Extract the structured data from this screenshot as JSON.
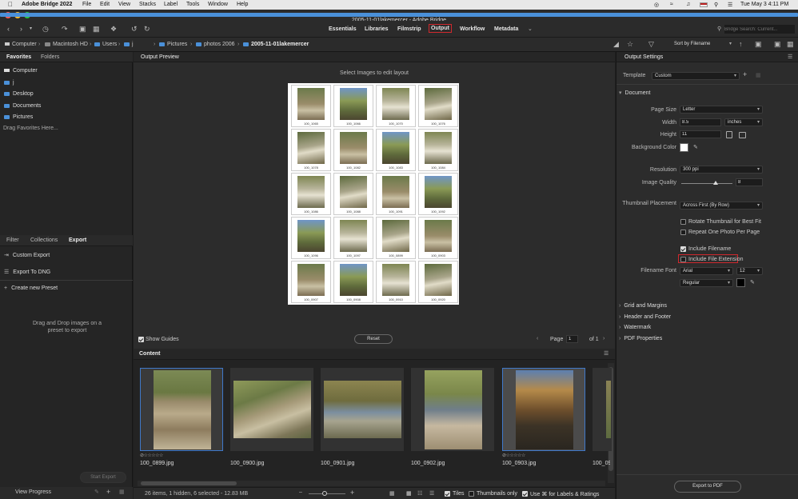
{
  "menubar": {
    "app_name": "Adobe Bridge 2022",
    "items": [
      "File",
      "Edit",
      "View",
      "Stacks",
      "Label",
      "Tools",
      "Window",
      "Help"
    ],
    "clock": "Tue May 3  4:11 PM"
  },
  "window": {
    "title": "2005-11-01lakemercer - Adobe Bridge"
  },
  "workspaces": [
    {
      "label": "Essentials",
      "active": false
    },
    {
      "label": "Libraries",
      "active": false
    },
    {
      "label": "Filmstrip",
      "active": false
    },
    {
      "label": "Output",
      "active": true
    },
    {
      "label": "Workflow",
      "active": false
    },
    {
      "label": "Metadata",
      "active": false
    }
  ],
  "search": {
    "placeholder": "Bridge Search: Current..."
  },
  "breadcrumb": [
    "Computer",
    "Macintosh HD",
    "Users",
    "j",
    "Pictures",
    "photos 2006",
    "2005-11-01lakemercer"
  ],
  "sort": {
    "label": "Sort by Filename"
  },
  "left": {
    "tabs": [
      "Favorites",
      "Folders"
    ],
    "favorites": [
      "Computer",
      "j",
      "Desktop",
      "Documents",
      "Pictures"
    ],
    "drag_hint": "Drag Favorites Here...",
    "lower_tabs": [
      "Filter",
      "Collections",
      "Export"
    ],
    "export_items": [
      "Custom Export",
      "Export To DNG"
    ],
    "create_preset": "Create new Preset",
    "drop_hint": "Drag and Drop images on a preset to export",
    "start_export": "Start Export",
    "view_progress": "View Progress"
  },
  "preview": {
    "tab": "Output Preview",
    "hint": "Select Images to edit layout",
    "captions": [
      "100_1065",
      "100_1066",
      "100_1070",
      "100_1076",
      "100_1078",
      "100_1082",
      "100_1083",
      "100_1084",
      "100_1086",
      "100_1088",
      "100_1091",
      "100_1092",
      "100_1096",
      "100_1097",
      "100_0899",
      "100_0903",
      "100_0907",
      "100_0908",
      "100_0910",
      "100_0920"
    ],
    "show_guides": "Show Guides",
    "reset": "Reset",
    "page_label": "Page",
    "page_value": "1",
    "page_of": "of 1"
  },
  "content": {
    "tab": "Content",
    "files": [
      {
        "name": "100_0899.jpg",
        "selected": true
      },
      {
        "name": "100_0900.jpg",
        "selected": false
      },
      {
        "name": "100_0901.jpg",
        "selected": false
      },
      {
        "name": "100_0902.jpg",
        "selected": false
      },
      {
        "name": "100_0903.jpg",
        "selected": true
      },
      {
        "name": "100_09"
      }
    ],
    "status": "26 items, 1 hidden, 6 selected - 12.83 MB",
    "tiles": "Tiles",
    "thumbs_only": "Thumbnails only",
    "use_cmd": "Use ⌘ for Labels & Ratings"
  },
  "settings": {
    "tab": "Output Settings",
    "template_label": "Template",
    "template_value": "Custom",
    "document_section": "Document",
    "page_size_label": "Page Size",
    "page_size_value": "Letter",
    "width_label": "Width",
    "width_value": "8.5",
    "units_value": "inches",
    "height_label": "Height",
    "height_value": "11",
    "bg_label": "Background Color",
    "resolution_label": "Resolution",
    "resolution_value": "300 ppi",
    "quality_label": "Image Quality",
    "quality_value": "8",
    "placement_label": "Thumbnail Placement",
    "placement_value": "Across First (By Row)",
    "rotate_label": "Rotate Thumbnail for Best Fit",
    "repeat_label": "Repeat One Photo Per Page",
    "include_filename_label": "Include Filename",
    "include_ext_label": "Include File Extension",
    "font_label": "Filename Font",
    "font_value": "Arial",
    "font_size_value": "12",
    "font_style_value": "Regular",
    "sections": [
      "Grid and Margins",
      "Header and Footer",
      "Watermark",
      "PDF Properties"
    ],
    "export_pdf": "Export to PDF"
  },
  "colors": {
    "accent": "#3f78c9",
    "highlight": "#d0282d",
    "folder": "#4a90d9"
  }
}
